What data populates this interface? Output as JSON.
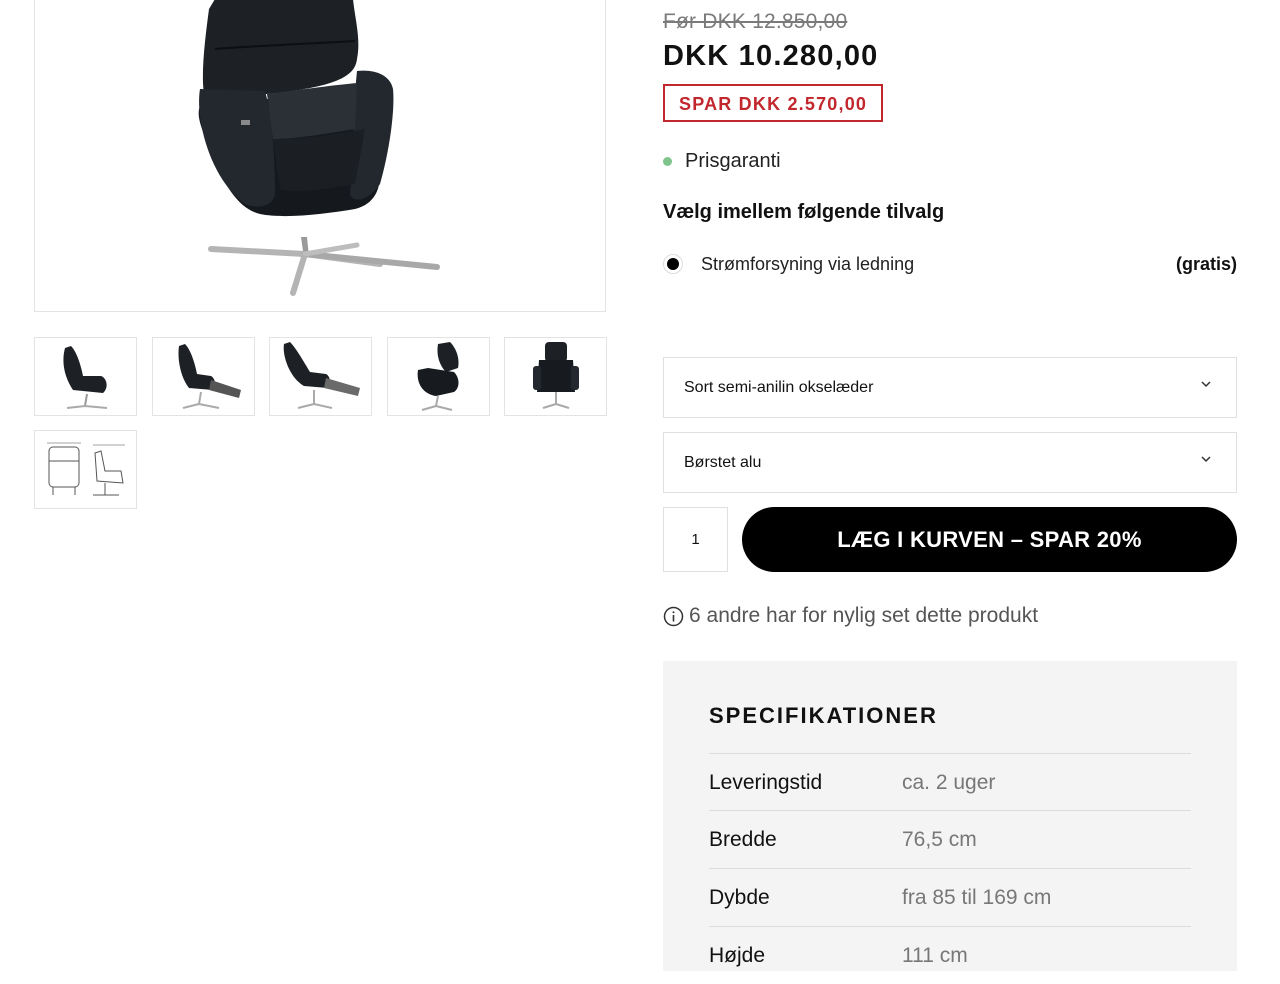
{
  "product": {
    "old_price": "Før DKK 12.850,00",
    "price": "DKK 10.280,00",
    "savings": "SPAR DKK 2.570,00",
    "guarantee": "Prisgaranti"
  },
  "options": {
    "title": "Vælg imellem følgende tilvalg",
    "items": [
      {
        "label": "Strømforsyning via ledning",
        "price": "(gratis)",
        "selected": true
      }
    ]
  },
  "selects": {
    "material": "Sort semi-anilin okselæder",
    "frame": "Børstet alu"
  },
  "cart": {
    "quantity": "1",
    "button_label": "LÆG I KURVEN – SPAR 20%"
  },
  "viewers_text": "6 andre har for nylig set dette produkt",
  "specs": {
    "title": "SPECIFIKATIONER",
    "rows": [
      {
        "key": "Leveringstid",
        "value": "ca. 2 uger"
      },
      {
        "key": "Bredde",
        "value": "76,5 cm"
      },
      {
        "key": "Dybde",
        "value": "fra 85 til 169 cm"
      },
      {
        "key": "Højde",
        "value": "111 cm"
      }
    ]
  },
  "gallery": {
    "thumbnails": [
      "chair-side",
      "chair-side-reclined",
      "chair-side-extended",
      "chair-three-quarter",
      "chair-front",
      "chair-dimensions-drawing"
    ]
  },
  "colors": {
    "accent_red": "#c2272d",
    "status_green": "#7fc48a",
    "button_black": "#000000",
    "spec_background": "#f4f4f4"
  }
}
